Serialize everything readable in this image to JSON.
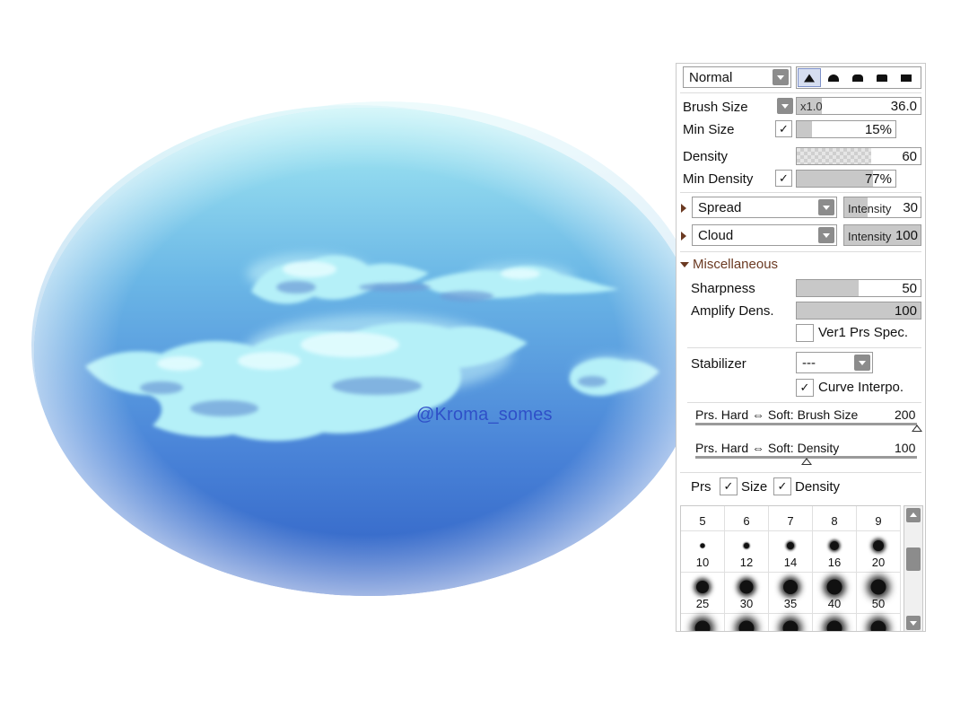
{
  "watermark": "@Kroma_somes",
  "colors": {
    "sky_light": "#a6ecf3",
    "sky_mid": "#5d9fdf",
    "sky_dark": "#2f5fc4",
    "cloud": "#a9ecf6",
    "accent_brown": "#6b3a22"
  },
  "panel": {
    "blend_mode": "Normal",
    "brush_size": {
      "label": "Brush Size",
      "multiplier": "x1.0",
      "value": "36.0",
      "level": 0.2
    },
    "min_size": {
      "label": "Min Size",
      "checked": "✓",
      "value": "15%",
      "level": 0.15
    },
    "density": {
      "label": "Density",
      "value": "60",
      "level": 0.6
    },
    "min_density": {
      "label": "Min Density",
      "checked": "✓",
      "value": "77%",
      "level": 0.77
    },
    "texture": {
      "value": "Spread",
      "intensity_label": "Intensity",
      "intensity": "30"
    },
    "shape": {
      "value": "Cloud",
      "intensity_label": "Intensity",
      "intensity": "100"
    },
    "misc": {
      "title": "Miscellaneous",
      "sharpness": {
        "label": "Sharpness",
        "value": "50",
        "level": 0.5
      },
      "amplify": {
        "label": "Amplify Dens.",
        "value": "100",
        "level": 1.0
      },
      "ver1": {
        "label": "Ver1 Prs Spec.",
        "checked": ""
      },
      "stabilizer": {
        "label": "Stabilizer",
        "value": "---"
      },
      "curve_interp": {
        "label": "Curve Interpo.",
        "checked": "✓"
      }
    },
    "prs_brush": {
      "label": "Prs. Hard ⇔ Soft: Brush Size",
      "value": "200",
      "level": 1.0
    },
    "prs_density": {
      "label": "Prs. Hard ⇔ Soft: Density",
      "value": "100",
      "level": 0.5
    },
    "prs": {
      "label": "Prs",
      "size_label": "Size",
      "size_checked": "✓",
      "density_label": "Density",
      "density_checked": "✓"
    },
    "sizes": [
      {
        "label": "5",
        "dot": 0
      },
      {
        "label": "6",
        "dot": 0
      },
      {
        "label": "7",
        "dot": 0
      },
      {
        "label": "8",
        "dot": 0
      },
      {
        "label": "9",
        "dot": 0
      },
      {
        "label": "10",
        "dot": 1
      },
      {
        "label": "12",
        "dot": 2
      },
      {
        "label": "14",
        "dot": 3
      },
      {
        "label": "16",
        "dot": 4
      },
      {
        "label": "20",
        "dot": 5
      },
      {
        "label": "25",
        "dot": 6
      },
      {
        "label": "30",
        "dot": 7
      },
      {
        "label": "35",
        "dot": 8
      },
      {
        "label": "40",
        "dot": 9
      },
      {
        "label": "50",
        "dot": 10
      },
      {
        "label": "",
        "dot": 10
      },
      {
        "label": "",
        "dot": 10
      },
      {
        "label": "",
        "dot": 10
      },
      {
        "label": "",
        "dot": 10
      },
      {
        "label": "",
        "dot": 10
      }
    ]
  }
}
